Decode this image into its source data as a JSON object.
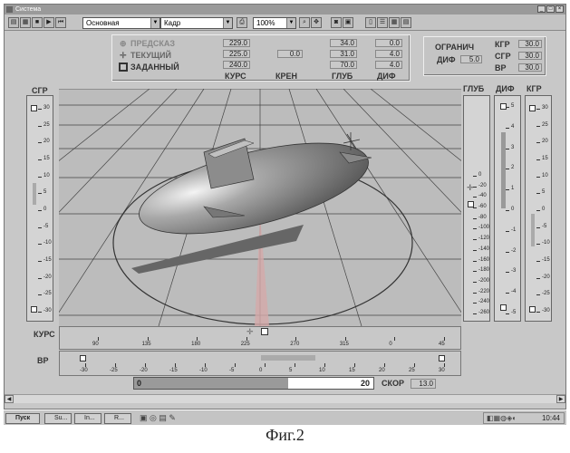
{
  "window": {
    "title": "Система"
  },
  "toolbar": {
    "mode_select": "Основная",
    "frame_select": "Кадр",
    "zoom_select": "100%"
  },
  "params_panel": {
    "legend": {
      "predicted": "ПРЕДСКАЗ",
      "current": "ТЕКУЩИЙ",
      "target": "ЗАДАННЫЙ"
    },
    "columns": {
      "kurs": "КУРС",
      "kren": "КРЕН",
      "glub": "ГЛУБ",
      "dif": "ДИФ"
    },
    "rows": [
      {
        "kurs": "229.0",
        "kren": "",
        "glub": "34.0",
        "dif": "0.0"
      },
      {
        "kurs": "225.0",
        "kren": "0.0",
        "glub": "31.0",
        "dif": "4.0"
      },
      {
        "kurs": "240.0",
        "kren": "",
        "glub": "70.0",
        "dif": "4.0"
      }
    ]
  },
  "limits_panel": {
    "title": "ОГРАНИЧ",
    "dif_label": "ДИФ",
    "dif_value": "5.0",
    "items": [
      {
        "label": "КГР",
        "value": "30.0"
      },
      {
        "label": "СГР",
        "value": "30.0"
      },
      {
        "label": "ВР",
        "value": "30.0"
      }
    ]
  },
  "scales": {
    "sgr": {
      "label": "СГР",
      "ticks": [
        "30",
        "25",
        "20",
        "15",
        "10",
        "5",
        "0",
        "-5",
        "-10",
        "-15",
        "-20",
        "-25",
        "-30"
      ]
    },
    "glub": {
      "label": "ГЛУБ",
      "ticks": [
        "0",
        "-20",
        "-40",
        "-60",
        "-80",
        "-100",
        "-120",
        "-140",
        "-160",
        "-180",
        "-200",
        "-220",
        "-240",
        "-260"
      ]
    },
    "dif": {
      "label": "ДИФ",
      "ticks": [
        "5",
        "4",
        "3",
        "2",
        "1",
        "0",
        "-1",
        "-2",
        "-3",
        "-4",
        "-5"
      ]
    },
    "kgr": {
      "label": "КГР",
      "ticks": [
        "30",
        "25",
        "20",
        "15",
        "10",
        "5",
        "0",
        "-5",
        "-10",
        "-15",
        "-20",
        "-25",
        "-30"
      ]
    },
    "kurs": {
      "label": "КУРС",
      "ticks": [
        "90",
        "135",
        "180",
        "225",
        "270",
        "315",
        "0",
        "45"
      ]
    },
    "vr": {
      "label": "ВР",
      "ticks": [
        "-30",
        "-25",
        "-20",
        "-15",
        "-10",
        "-5",
        "0",
        "5",
        "10",
        "15",
        "20",
        "25",
        "30"
      ]
    }
  },
  "speed": {
    "min": "0",
    "value": "20",
    "label": "СКОР",
    "readout": "13.0"
  },
  "taskbar": {
    "start": "Пуск",
    "tasks": [
      "Su...",
      "In...",
      "R..."
    ],
    "clock": "10:44"
  },
  "figure_caption": "Фиг.2"
}
